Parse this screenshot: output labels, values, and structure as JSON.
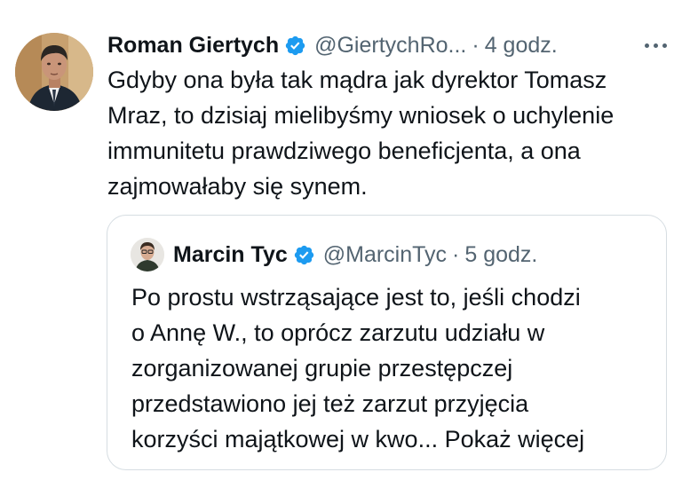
{
  "tweet": {
    "author_name": "Roman Giertych",
    "handle": "@GiertychRo...",
    "separator": "·",
    "time": "4 godz.",
    "text_lines": [
      "Gdyby ona była tak mądra jak dyrektor Tomasz",
      "Mraz, to dzisiaj mielibyśmy wniosek o uchylenie",
      "immunitetu prawdziwego beneficjenta, a ona",
      "zajmowałaby się synem."
    ]
  },
  "quoted_tweet": {
    "author_name": "Marcin Tyc",
    "handle": "@MarcinTyc",
    "separator": "·",
    "time": "5 godz.",
    "text_lines": [
      "Po prostu wstrząsające jest to, jeśli chodzi",
      "o Annę W., to oprócz zarzutu udziału w",
      "zorganizowanej grupie przestępczej",
      "przedstawiono jej też zarzut przyjęcia",
      "korzyści majątkowej w kwo..."
    ],
    "show_more_label": "Pokaż więcej"
  },
  "icons": {
    "verified": "verified-badge-icon",
    "more": "more-horizontal-icon"
  },
  "colors": {
    "verified_blue": "#1d9bf0",
    "secondary_text": "#536471",
    "border": "#d6dde2"
  }
}
